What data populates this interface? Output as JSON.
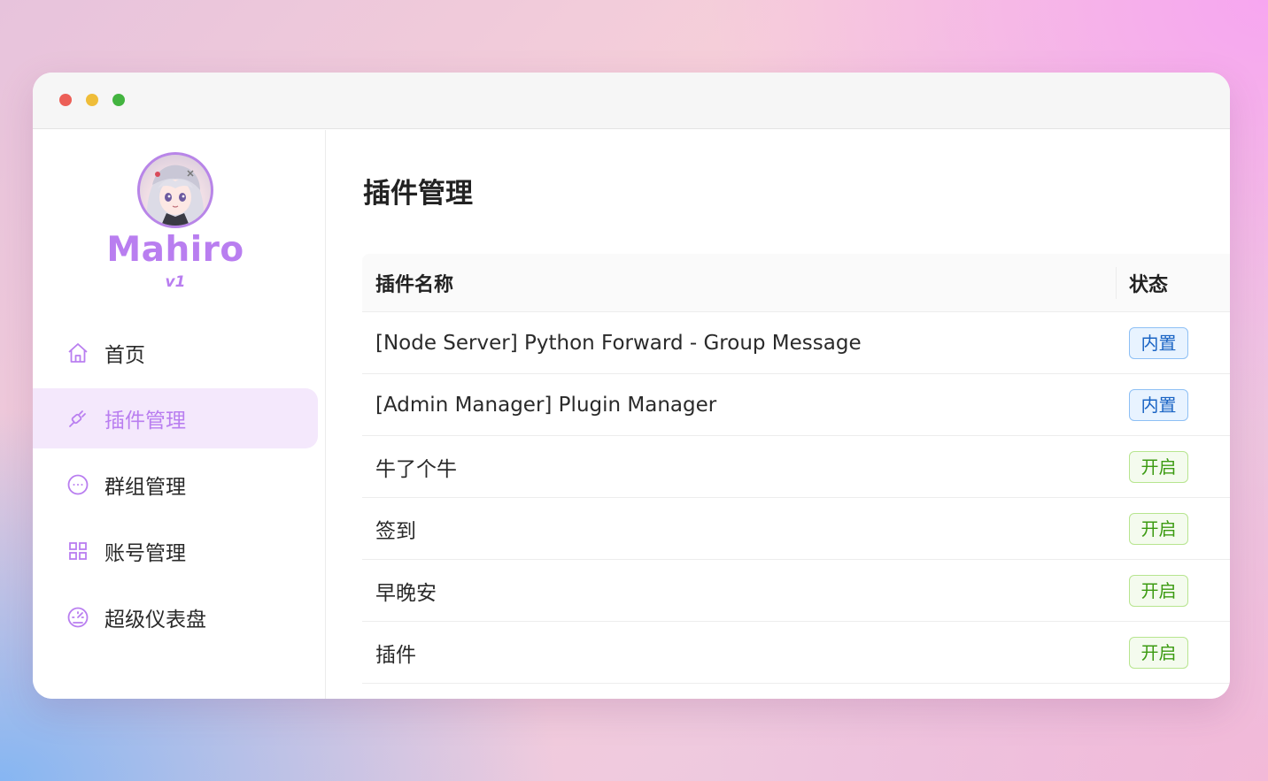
{
  "sidebar": {
    "brand": "Mahiro",
    "version": "v1",
    "items": [
      {
        "label": "首页",
        "icon": "home-icon",
        "active": false
      },
      {
        "label": "插件管理",
        "icon": "plug-icon",
        "active": true
      },
      {
        "label": "群组管理",
        "icon": "chat-icon",
        "active": false
      },
      {
        "label": "账号管理",
        "icon": "grid-icon",
        "active": false
      },
      {
        "label": "超级仪表盘",
        "icon": "dashboard-icon",
        "active": false
      }
    ]
  },
  "main": {
    "title": "插件管理",
    "table": {
      "headers": {
        "name": "插件名称",
        "status": "状态"
      },
      "rows": [
        {
          "name": "[Node Server] Python Forward - Group Message",
          "status": "内置",
          "kind": "builtin"
        },
        {
          "name": "[Admin Manager] Plugin Manager",
          "status": "内置",
          "kind": "builtin"
        },
        {
          "name": "牛了个牛",
          "status": "开启",
          "kind": "on"
        },
        {
          "name": "签到",
          "status": "开启",
          "kind": "on"
        },
        {
          "name": "早晚安",
          "status": "开启",
          "kind": "on"
        },
        {
          "name": "插件",
          "status": "开启",
          "kind": "on"
        }
      ]
    }
  },
  "colors": {
    "accent": "#b97ef0",
    "active_bg": "#f4e8fc",
    "builtin_tag": "#1a64c4",
    "on_tag": "#3c9b12"
  }
}
